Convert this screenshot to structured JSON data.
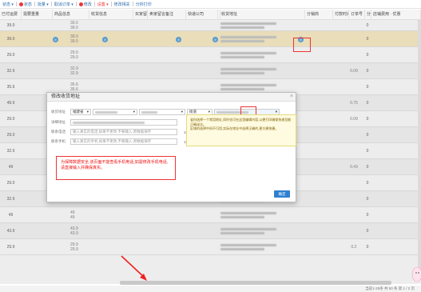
{
  "toolbar": {
    "items": [
      {
        "label": "状态 ▾",
        "color": "#2a6db0"
      },
      {
        "label": "状态",
        "color": "#e33"
      },
      {
        "label": "批量 ▾",
        "color": "#2a6db0"
      },
      {
        "label": "取消订单 ▾",
        "color": "#2a6db0"
      },
      {
        "label": "修改",
        "color": "#2a6db0"
      },
      {
        "label": "设置 ▾",
        "color": "#e33"
      },
      {
        "label": "修改相关",
        "color": "#2a6db0"
      },
      {
        "label": "分析打印",
        "color": "#2a6db0"
      }
    ]
  },
  "table": {
    "headers": [
      "已付运费",
      "需要重量",
      "商品信息",
      "收货信息",
      "买家留言",
      "卖家留言备注",
      "快递公司",
      "备注",
      "收货地址",
      "分销商",
      "付款时间",
      "订单号",
      "分销利润",
      "店铺费用 · 优惠"
    ],
    "rows": [
      {
        "weight": "39.0",
        "price": [
          "39.0",
          "39.0"
        ],
        "zero": "0"
      },
      {
        "weight": "39.0",
        "price": [
          "39.0",
          "39.0"
        ],
        "zero": "0",
        "selected": true
      },
      {
        "weight": "29.0",
        "price": [
          "29.0",
          "29.0"
        ],
        "zero": "0"
      },
      {
        "weight": "32.9",
        "price": [
          "32.9",
          "32.9"
        ],
        "zero": "0",
        "side": "0.09"
      },
      {
        "weight": "35.6",
        "price": [
          "35.6",
          "35.6"
        ],
        "zero": "0"
      },
      {
        "weight": "49.9",
        "price": [
          "49.9",
          "49.9"
        ],
        "zero": "0",
        "side": "0.75"
      },
      {
        "weight": "29.0",
        "price": [
          "29.0",
          "29.0"
        ],
        "zero": "0",
        "side": "0.09"
      },
      {
        "weight": "29.0",
        "price": [
          "29.0",
          "29.0"
        ],
        "zero": "0"
      },
      {
        "weight": "32.9",
        "price": [
          "32.9",
          "32.9"
        ],
        "zero": "0"
      },
      {
        "weight": "49",
        "price": [
          "49",
          "49"
        ],
        "zero": "0",
        "side": "0.43"
      },
      {
        "weight": "29.0",
        "price": [
          "29.0",
          "29.0"
        ],
        "zero": "0"
      },
      {
        "weight": "32.9",
        "price": [
          "32.9",
          "32.9"
        ],
        "zero": "0"
      },
      {
        "weight": "49",
        "price": [
          "49",
          "49"
        ],
        "zero": "0"
      },
      {
        "weight": "43.9",
        "price": [
          "43.9",
          "43.9"
        ],
        "zero": "0"
      },
      {
        "weight": "29.9",
        "price": [
          "29.9",
          "29.9"
        ],
        "zero": "0",
        "side": "0.2"
      }
    ]
  },
  "dialog": {
    "title": "修改收货地址",
    "close": "×",
    "fields": {
      "region_label": "收货地址",
      "province": "福建省",
      "city": "",
      "district": "",
      "street": "街道",
      "detail_label": "详细地址",
      "phone_label": "联系电话",
      "phone_placeholder": "输入真实的电话,如果不更改,不要输入,原数据保存",
      "phone_suffix": "153*****",
      "mobile_label": "联系手机",
      "mobile_placeholder": "输入真实的手机,如果不更改,不要输入,原数据保存",
      "mobile_suffix": "153*****"
    },
    "tip": "省份选择一个常用地址,同时也可在这里编辑内容,以便打印确保快递员能正确送达。\n区域的选择中间不可用,实际在地址中选择正确的,更方便快捷。",
    "red_note": "为保障数据安全,该页面不能查看手机电话,如需修改手机电话,请直接输入并确保真实。",
    "confirm": "确定"
  },
  "footer": {
    "pagination": "当前1-25条  共 50 条  第 1 / 2 页"
  },
  "colors": {
    "accent": "#2f7fd1",
    "highlight": "#e33",
    "selected_row": "#fbeec9"
  }
}
